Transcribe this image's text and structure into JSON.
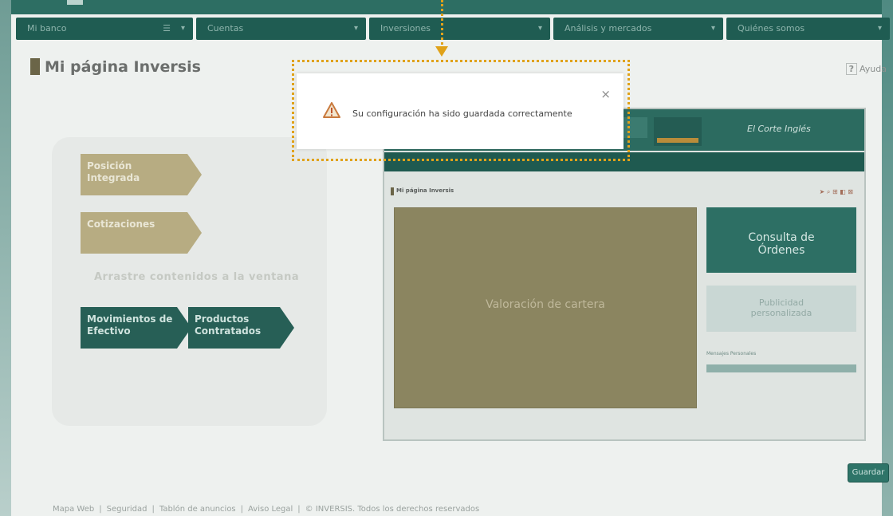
{
  "nav": {
    "items": [
      {
        "label": "Mi banco",
        "menu_icon": true,
        "width": 222
      },
      {
        "label": "Cuentas",
        "width": 213
      },
      {
        "label": "Inversiones",
        "width": 227
      },
      {
        "label": "Análisis y mercados",
        "width": 213
      },
      {
        "label": "Quiénes somos",
        "width": 210
      }
    ]
  },
  "header": {
    "title": "Mi página Inversis",
    "help_q": "?",
    "help_label": "Ayuda"
  },
  "left_panel": {
    "tiles": [
      {
        "label": "Posición\nIntegrada"
      },
      {
        "label": "Cotizaciones"
      },
      {
        "label": "Movimientos de\nEfectivo"
      },
      {
        "label": "Productos\nContratados"
      }
    ],
    "drag_hint": "Arrastre contenidos a la ventana"
  },
  "preview": {
    "title": "Mi página Inversis",
    "brand": "El Corte Inglés",
    "valoracion": "Valoración de cartera",
    "consulta": "Consulta de\nÓrdenes",
    "publicidad": "Publicidad\npersonalizada",
    "mensajes_title": "Mensajes Personales"
  },
  "dialog": {
    "message": "Su configuración ha sido guardada correctamente",
    "close": "×"
  },
  "actions": {
    "save_label": "Guardar"
  },
  "footer": {
    "links": [
      "Mapa Web",
      "Seguridad",
      "Tablón de anuncios",
      "Aviso Legal"
    ],
    "copyright": "© INVERSIS. Todos los derechos reservados"
  },
  "colors": {
    "accent": "#e0a21a",
    "primary": "#1f5c52",
    "gold": "#b7ac82"
  }
}
